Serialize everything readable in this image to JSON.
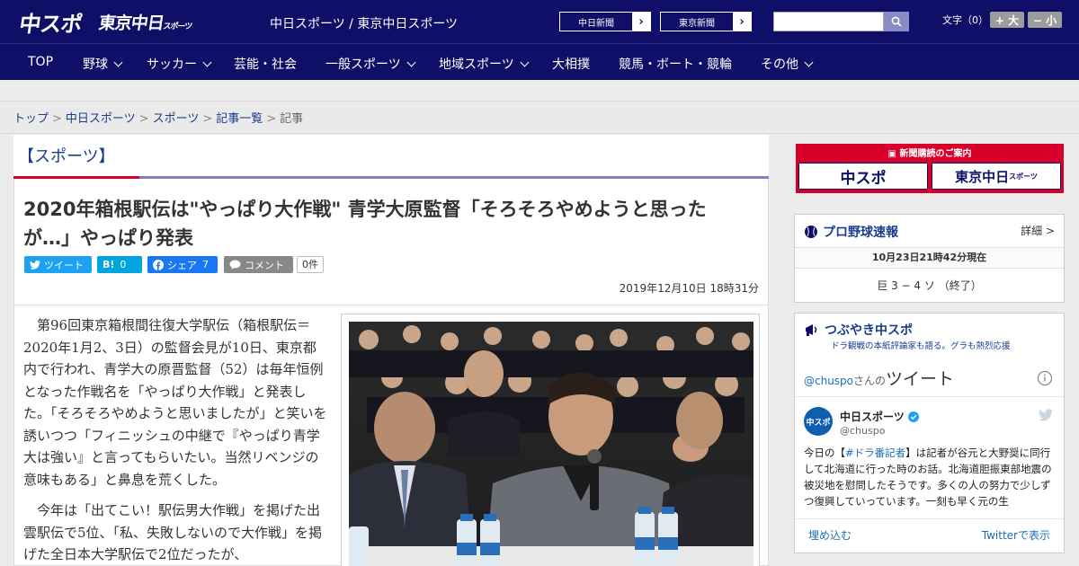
{
  "header": {
    "logo_main": "中スポ",
    "logo_tokyo": "東京中日",
    "logo_tokyo_sub": "スポーツ",
    "site_title": "中日スポーツ / 東京中日スポーツ",
    "link_chunichi": "中日新聞",
    "link_tokyo": "東京新聞",
    "search_placeholder": "",
    "font_label": "文字（0）",
    "font_plus": "+ 大",
    "font_minus": "− 小"
  },
  "nav": [
    {
      "label": "TOP",
      "dropdown": false
    },
    {
      "label": "野球",
      "dropdown": true
    },
    {
      "label": "サッカー",
      "dropdown": true
    },
    {
      "label": "芸能・社会",
      "dropdown": false
    },
    {
      "label": "一般スポーツ",
      "dropdown": true
    },
    {
      "label": "地域スポーツ",
      "dropdown": true
    },
    {
      "label": "大相撲",
      "dropdown": false
    },
    {
      "label": "競馬・ボート・競輪",
      "dropdown": false
    },
    {
      "label": "その他",
      "dropdown": true
    }
  ],
  "breadcrumb": [
    "トップ",
    "中日スポーツ",
    "スポーツ",
    "記事一覧",
    "記事"
  ],
  "section_title": "【スポーツ】",
  "article": {
    "headline": "2020年箱根駅伝は\"やっぱり大作戦\" 青学大原監督「そろそろやめようと思ったが…」やっぱり発表",
    "share": {
      "tweet": "ツイート",
      "hatena": "B!",
      "hatena_count": "0",
      "facebook": "シェア",
      "facebook_count": "7",
      "comment": "コメント",
      "comment_count": "0件"
    },
    "date": "2019年12月10日 18時31分",
    "paragraphs": [
      "第96回東京箱根間往復大学駅伝（箱根駅伝＝2020年1月2、3日）の監督会見が10日、東京都内で行われ、青学大の原晋監督（52）は毎年恒例となった作戦名を「やっぱり大作戦」と発表した。「そろそろやめようと思いましたが」と笑いを誘いつつ「フィニッシュの中継で『やっぱり青学大は強い』と言ってもらいたい。当然リベンジの意味もある」と鼻息を荒くした。",
      "今年は「出てこい！駅伝男大作戦」を掲げた出雲駅伝で5位、「私、失敗しないので大作戦」を掲げた全日本大学駅伝で2位だったが、"
    ]
  },
  "sidebar": {
    "ad_header": "新聞購読のご案内",
    "ad_chuspo": "中スポ",
    "ad_tokyo": "東京中日",
    "ad_tokyo_sub": "スポーツ",
    "baseball": {
      "title": "プロ野球速報",
      "detail": "詳細 >",
      "updated": "10月23日21時42分現在",
      "score": "巨 3 − 4 ソ （終了）"
    },
    "twitter": {
      "title": "つぶやき中スポ",
      "subtitle": "ドラ観戦の本紙評論家も語る。グラも熱烈応援",
      "handle_link": "@chuspo",
      "handle_suffix": "さんの",
      "tweets_label": "ツイート",
      "account_name": "中日スポーツ",
      "account_handle": "@chuspo",
      "tweet_pre": "今日の【",
      "tweet_tag": "#ドラ番記者",
      "tweet_post": "】は記者が谷元と大野奨に同行して北海道に行った時のお話。北海道胆振東部地震の被災地を慰問したそうです。多くの人の努力で少しずつ復興していっています。一刻も早く元の生",
      "embed": "埋め込む",
      "view_on": "Twitterで表示"
    }
  },
  "colors": {
    "brand_navy": "#0f0f68",
    "accent_red": "#d8002a",
    "twitter_blue": "#1da1f2",
    "link_blue": "#1a3c8c"
  }
}
